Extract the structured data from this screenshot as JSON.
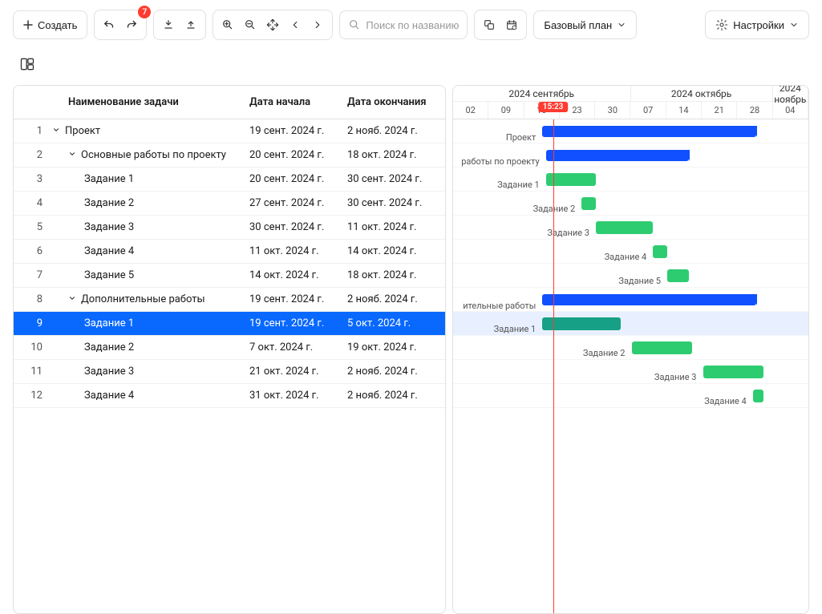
{
  "toolbar": {
    "create": "Создать",
    "undo_badge": "7",
    "search_placeholder": "Поиск по названию",
    "baseline": "Базовый план",
    "settings": "Настройки"
  },
  "columns": {
    "name": "Наименование задачи",
    "start": "Дата начала",
    "end": "Дата окончания"
  },
  "timeline": {
    "months": [
      {
        "label": "2024 сентябрь",
        "days": 5
      },
      {
        "label": "2024 октябрь",
        "days": 4
      },
      {
        "label": "2024 ноябрь",
        "days": 1
      }
    ],
    "days": [
      "02",
      "09",
      "16",
      "23",
      "30",
      "07",
      "14",
      "21",
      "28",
      "04"
    ],
    "today_label": "15:23",
    "today_index": 2.8
  },
  "rows": [
    {
      "n": 1,
      "indent": 0,
      "caret": true,
      "name": "Проект",
      "start": "19 сент. 2024 г.",
      "end": "2 нояб. 2024 г.",
      "bar": {
        "from": 2.5,
        "to": 8.5,
        "type": "blue",
        "summary": true,
        "label": "Проект"
      }
    },
    {
      "n": 2,
      "indent": 1,
      "caret": true,
      "name": "Основные работы по проекту",
      "start": "20 сент. 2024 г.",
      "end": "18 окт. 2024 г.",
      "bar": {
        "from": 2.6,
        "to": 6.6,
        "type": "blue",
        "summary": true,
        "label": "работы по проекту"
      }
    },
    {
      "n": 3,
      "indent": 2,
      "caret": false,
      "name": "Задание 1",
      "start": "20 сент. 2024 г.",
      "end": "30 сент. 2024 г.",
      "bar": {
        "from": 2.6,
        "to": 4.0,
        "type": "green",
        "label": "Задание 1"
      }
    },
    {
      "n": 4,
      "indent": 2,
      "caret": false,
      "name": "Задание 2",
      "start": "27 сент. 2024 г.",
      "end": "30 сент. 2024 г.",
      "bar": {
        "from": 3.6,
        "to": 4.0,
        "type": "green",
        "label": "Задание 2"
      }
    },
    {
      "n": 5,
      "indent": 2,
      "caret": false,
      "name": "Задание 3",
      "start": "30 сент. 2024 г.",
      "end": "11 окт. 2024 г.",
      "bar": {
        "from": 4.0,
        "to": 5.6,
        "type": "green",
        "label": "Задание 3"
      }
    },
    {
      "n": 6,
      "indent": 2,
      "caret": false,
      "name": "Задание 4",
      "start": "11 окт. 2024 г.",
      "end": "14 окт. 2024 г.",
      "bar": {
        "from": 5.6,
        "to": 6.0,
        "type": "green",
        "label": "Задание 4"
      }
    },
    {
      "n": 7,
      "indent": 2,
      "caret": false,
      "name": "Задание 5",
      "start": "14 окт. 2024 г.",
      "end": "18 окт. 2024 г.",
      "bar": {
        "from": 6.0,
        "to": 6.6,
        "type": "green",
        "label": "Задание 5"
      }
    },
    {
      "n": 8,
      "indent": 1,
      "caret": true,
      "name": "Дополнительные работы",
      "start": "19 сент. 2024 г.",
      "end": "2 нояб. 2024 г.",
      "bar": {
        "from": 2.5,
        "to": 8.5,
        "type": "blue",
        "summary": true,
        "label": "ительные работы"
      }
    },
    {
      "n": 9,
      "indent": 2,
      "caret": false,
      "name": "Задание 1",
      "start": "19 сент. 2024 г.",
      "end": "5 окт. 2024 г.",
      "bar": {
        "from": 2.5,
        "to": 4.7,
        "type": "green",
        "dark": true,
        "label": "Задание 1"
      },
      "selected": true
    },
    {
      "n": 10,
      "indent": 2,
      "caret": false,
      "name": "Задание 2",
      "start": "7 окт. 2024 г.",
      "end": "19 окт. 2024 г.",
      "bar": {
        "from": 5.0,
        "to": 6.7,
        "type": "green",
        "label": "Задание 2"
      }
    },
    {
      "n": 11,
      "indent": 2,
      "caret": false,
      "name": "Задание 3",
      "start": "21 окт. 2024 г.",
      "end": "2 нояб. 2024 г.",
      "bar": {
        "from": 7.0,
        "to": 8.7,
        "type": "green",
        "label": "Задание 3"
      }
    },
    {
      "n": 12,
      "indent": 2,
      "caret": false,
      "name": "Задание 4",
      "start": "31 окт. 2024 г.",
      "end": "2 нояб. 2024 г.",
      "bar": {
        "from": 8.4,
        "to": 8.7,
        "type": "green",
        "label": "Задание 4"
      }
    }
  ]
}
